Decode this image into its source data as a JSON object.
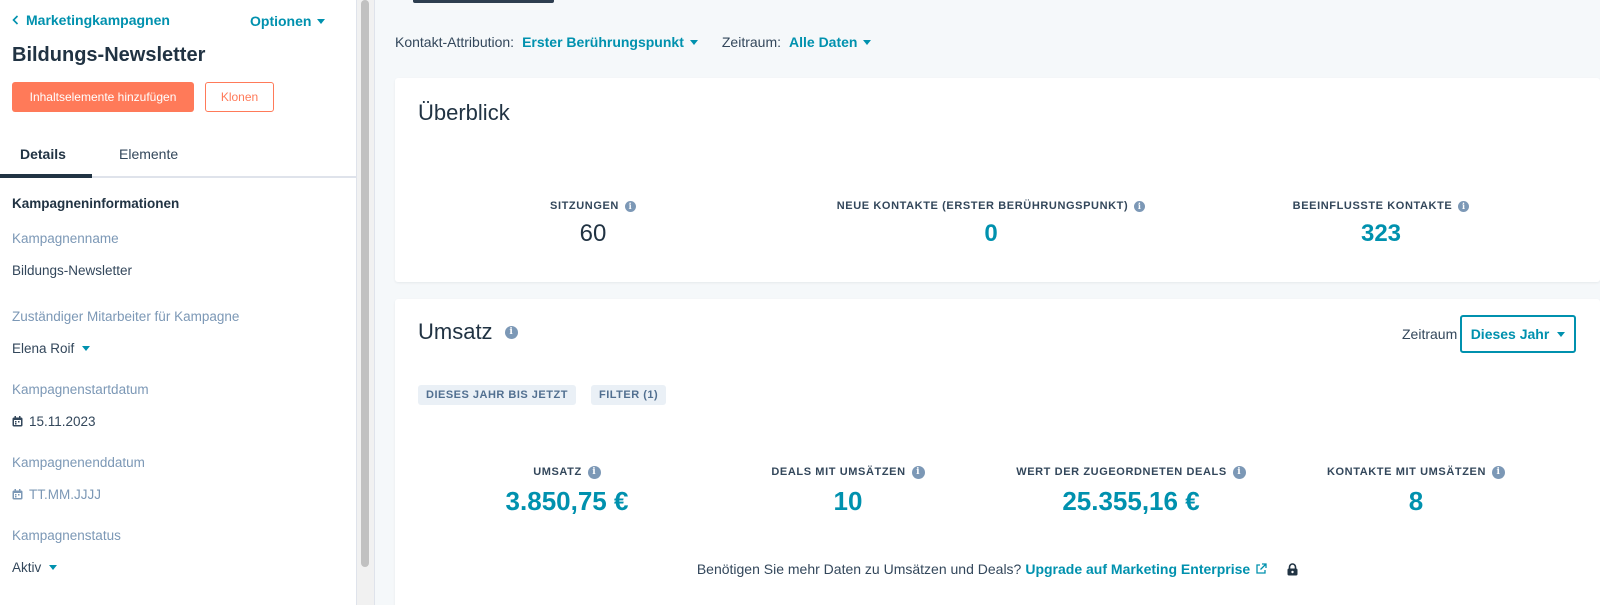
{
  "sidebar": {
    "back_label": "Marketingkampagnen",
    "options_label": "Optionen",
    "title": "Bildungs-Newsletter",
    "add_content_label": "Inhaltselemente hinzufügen",
    "clone_label": "Klonen",
    "tabs": [
      {
        "label": "Details",
        "active": true
      },
      {
        "label": "Elemente",
        "active": false
      }
    ],
    "section_heading": "Kampagneninformationen",
    "fields": {
      "name": {
        "label": "Kampagnenname",
        "value": "Bildungs-Newsletter"
      },
      "owner": {
        "label": "Zuständiger Mitarbeiter für Kampagne",
        "value": "Elena Roif"
      },
      "start": {
        "label": "Kampagnenstartdatum",
        "value": "15.11.2023"
      },
      "end": {
        "label": "Kampagnenenddatum",
        "placeholder": "TT.MM.JJJJ"
      },
      "status": {
        "label": "Kampagnenstatus",
        "value": "Aktiv"
      }
    }
  },
  "filters": {
    "attribution_label": "Kontakt-Attribution:",
    "attribution_value": "Erster Berührungspunkt",
    "period_label": "Zeitraum:",
    "period_value": "Alle Daten"
  },
  "overview": {
    "title": "Überblick",
    "stats": [
      {
        "label": "SITZUNGEN",
        "value": "60"
      },
      {
        "label": "NEUE KONTAKTE (ERSTER BERÜHRUNGSPUNKT)",
        "value": "0"
      },
      {
        "label": "BEEINFLUSSTE KONTAKTE",
        "value": "323"
      }
    ]
  },
  "revenue": {
    "title": "Umsatz",
    "period_label": "Zeitraum",
    "period_value": "Dieses Jahr",
    "tags": [
      "DIESES JAHR BIS JETZT",
      "FILTER (1)"
    ],
    "stats": [
      {
        "label": "UMSATZ",
        "value": "3.850,75 €"
      },
      {
        "label": "DEALS MIT UMSÄTZEN",
        "value": "10"
      },
      {
        "label": "WERT DER ZUGEORDNETEN DEALS",
        "value": "25.355,16 €"
      },
      {
        "label": "KONTAKTE MIT UMSÄTZEN",
        "value": "8"
      }
    ],
    "upgrade_text": "Benötigen Sie mehr Daten zu Umsätzen und Deals?",
    "upgrade_link": "Upgrade auf Marketing Enterprise"
  },
  "colors": {
    "accent": "#0091ae",
    "primary_button": "#ff7a59",
    "heading": "#213343",
    "muted": "#7c98b6"
  },
  "icons": [
    "chevron-left-icon",
    "caret-down-icon",
    "calendar-icon",
    "info-icon",
    "external-link-icon",
    "lock-icon"
  ]
}
